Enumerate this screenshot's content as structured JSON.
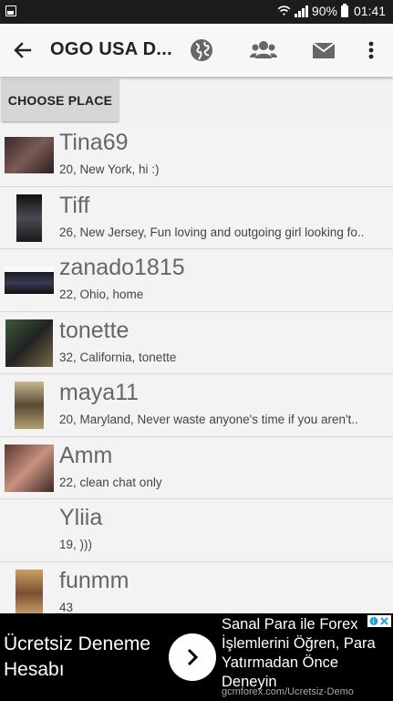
{
  "status_bar": {
    "battery": "90%",
    "time": "01:41"
  },
  "toolbar": {
    "title": "OGO USA D...",
    "icons": [
      "back-arrow-icon",
      "globe-icon",
      "group-icon",
      "mail-icon",
      "overflow-menu-icon"
    ]
  },
  "choose_place": {
    "label": "CHOOSE PLACE"
  },
  "users": [
    {
      "name": "Tina69",
      "desc": "20, New York, hi :)"
    },
    {
      "name": "Tiff",
      "desc": "26, New Jersey, Fun loving and outgoing girl looking fo.."
    },
    {
      "name": "zanado1815",
      "desc": "22, Ohio, home"
    },
    {
      "name": "tonette",
      "desc": "32, California, tonette"
    },
    {
      "name": "maya11",
      "desc": "20, Maryland, Never waste anyone's time if you aren't.."
    },
    {
      "name": "Amm",
      "desc": "22, clean chat only"
    },
    {
      "name": "Yliia",
      "desc": "19, )))"
    },
    {
      "name": "funmm",
      "desc": "43"
    }
  ],
  "ad": {
    "left_line1": "Ücretsiz Deneme",
    "left_line2": "Hesabı",
    "right_text": "Sanal Para ile Forex İşlemlerini Öğren, Para Yatırmadan Önce Deneyin",
    "url": "gcmforex.com/Ucretsiz-Demo"
  }
}
